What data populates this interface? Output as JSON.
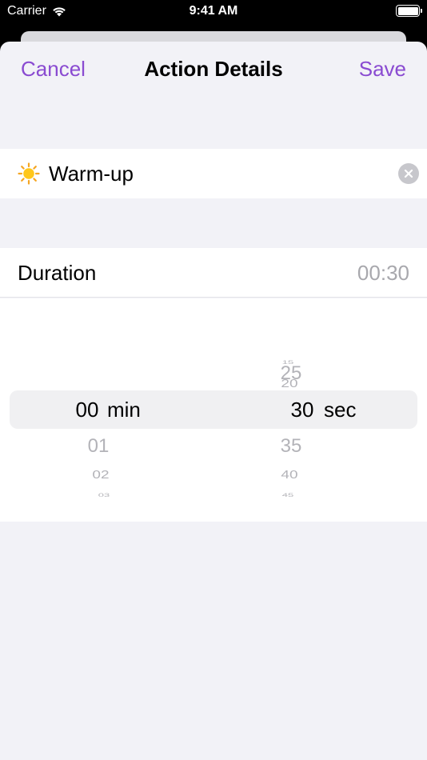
{
  "status_bar": {
    "carrier": "Carrier",
    "time": "9:41 AM"
  },
  "nav": {
    "cancel_label": "Cancel",
    "title": "Action Details",
    "save_label": "Save"
  },
  "action": {
    "icon": "sun-icon",
    "name": "Warm-up"
  },
  "duration": {
    "label": "Duration",
    "value": "00:30"
  },
  "picker": {
    "minutes": {
      "above": [],
      "selected": "00",
      "below": [
        "01",
        "02",
        "03"
      ],
      "unit": "min"
    },
    "seconds": {
      "above": [
        "15",
        "20",
        "25"
      ],
      "selected": "30",
      "below": [
        "35",
        "40",
        "45"
      ],
      "unit": "sec"
    }
  },
  "colors": {
    "accent": "#8a4bd1",
    "background": "#f2f2f7",
    "placeholder_gray": "#a8a8ad"
  }
}
